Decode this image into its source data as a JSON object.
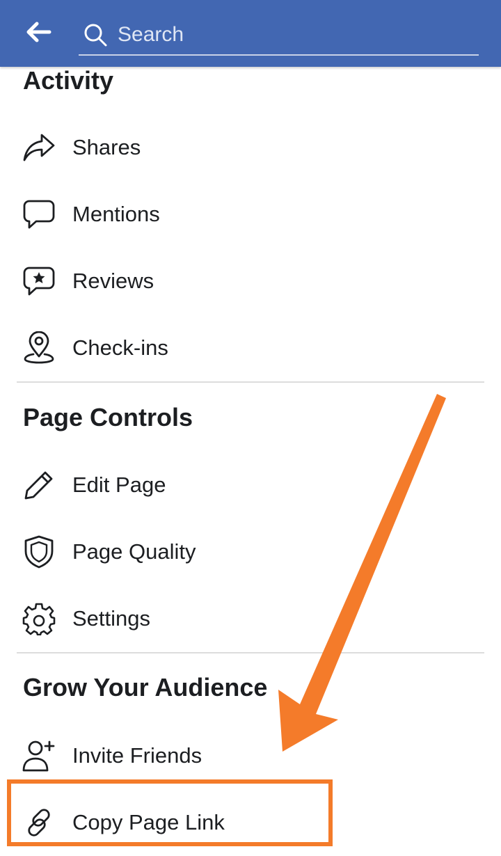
{
  "header": {
    "search_placeholder": "Search",
    "color": "#4267b2"
  },
  "sections": {
    "activity": {
      "title": "Activity",
      "items": [
        {
          "label": "Shares",
          "icon": "share-icon"
        },
        {
          "label": "Mentions",
          "icon": "comment-icon"
        },
        {
          "label": "Reviews",
          "icon": "review-star-icon"
        },
        {
          "label": "Check-ins",
          "icon": "location-pin-icon"
        }
      ]
    },
    "page_controls": {
      "title": "Page Controls",
      "items": [
        {
          "label": "Edit Page",
          "icon": "pencil-icon"
        },
        {
          "label": "Page Quality",
          "icon": "shield-icon"
        },
        {
          "label": "Settings",
          "icon": "gear-icon"
        }
      ]
    },
    "grow_audience": {
      "title": "Grow Your Audience",
      "items": [
        {
          "label": "Invite Friends",
          "icon": "add-person-icon"
        },
        {
          "label": "Copy Page Link",
          "icon": "link-icon"
        }
      ]
    }
  },
  "annotation": {
    "highlight_color": "#f47b2a",
    "target": "Copy Page Link"
  }
}
